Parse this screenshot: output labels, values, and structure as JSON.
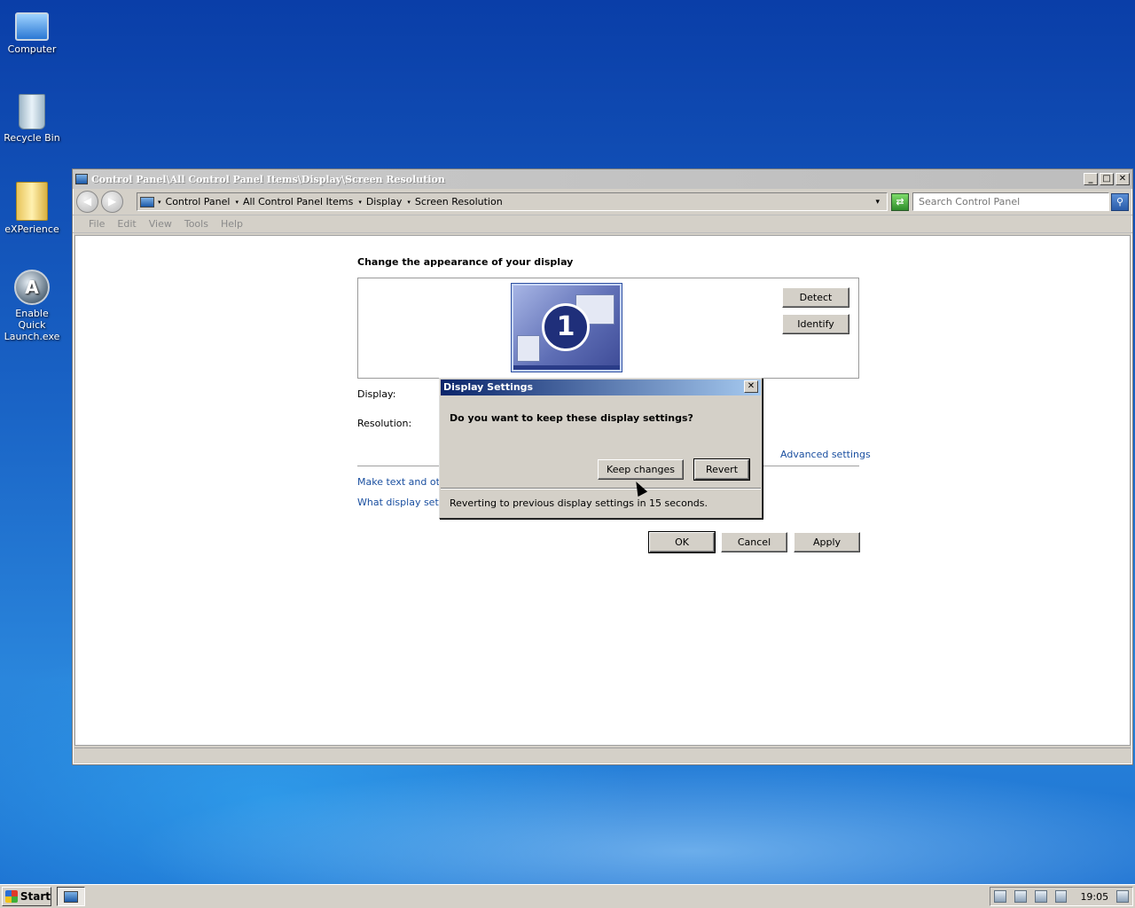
{
  "desktop": {
    "icons": [
      {
        "label": "Computer"
      },
      {
        "label": "Recycle Bin"
      },
      {
        "label": "eXPerience"
      },
      {
        "label": "Enable Quick Launch.exe",
        "glyph": "A"
      }
    ]
  },
  "window": {
    "title": "Control Panel\\All Control Panel Items\\Display\\Screen Resolution",
    "controls": {
      "minimize": "_",
      "maximize": "□",
      "close": "✕"
    },
    "nav": {
      "back": "◀",
      "forward": "▶"
    },
    "breadcrumbs": [
      "Control Panel",
      "All Control Panel Items",
      "Display",
      "Screen Resolution"
    ],
    "crumb_separator": "▾",
    "dropdown_arrow": "▾",
    "refresh_glyph": "⇄",
    "search": {
      "placeholder": "Search Control Panel",
      "button_glyph": "⚲"
    },
    "menu": [
      "File",
      "Edit",
      "View",
      "Tools",
      "Help"
    ]
  },
  "main": {
    "heading": "Change the appearance of your display",
    "monitor_number": "1",
    "detect_label": "Detect",
    "identify_label": "Identify",
    "display_label": "Display:",
    "resolution_label": "Resolution:",
    "advanced_link": "Advanced settings",
    "link_text_size": "Make text and othe",
    "link_which_settings": "What display settin",
    "ok_label": "OK",
    "cancel_label": "Cancel",
    "apply_label": "Apply"
  },
  "dialog": {
    "title": "Display Settings",
    "close_glyph": "✕",
    "question": "Do you want to keep these display settings?",
    "keep_label": "Keep changes",
    "revert_label": "Revert",
    "status": "Reverting to previous display settings in 15 seconds."
  },
  "taskbar": {
    "start_label": "Start",
    "clock": "19:05"
  },
  "colors": {
    "title_active_start": "#0a246a",
    "title_active_end": "#a6caf0",
    "link": "#1a4fa0",
    "face": "#d4d0c8"
  }
}
